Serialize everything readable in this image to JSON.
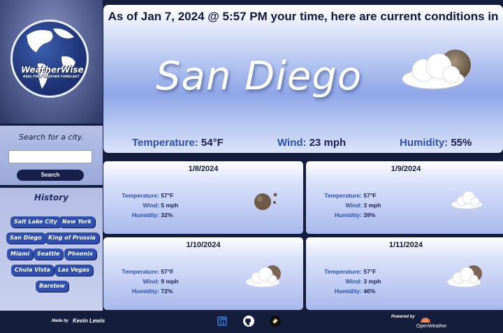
{
  "logo": {
    "brand": "WeatherWise",
    "tagline": "REAL-TIME WEATHER FORECAST"
  },
  "search": {
    "label": "Search for a city.",
    "value": "",
    "button": "Search"
  },
  "history": {
    "title": "History",
    "cities": [
      "Salt Lake City",
      "New York",
      "San Diego",
      "King of Prussia",
      "Miami",
      "Seattle",
      "Phoenix",
      "Chula Vista",
      "Las Vegas",
      "Barstow"
    ]
  },
  "current": {
    "headline": "As of Jan 7, 2024 @ 5:57 PM your time, here are current conditions in",
    "city": "San Diego",
    "icon": "night-partly-cloudy-icon",
    "temperature_label": "Temperature:",
    "temperature": "54°F",
    "wind_label": "Wind:",
    "wind": "23 mph",
    "humidity_label": "Humidity:",
    "humidity": "55%"
  },
  "forecast": [
    {
      "date": "1/8/2024",
      "icon": "night-clear-icon",
      "temp_label": "Temperature:",
      "temp": "57°F",
      "wind_label": "Wind:",
      "wind": "5 mph",
      "hum_label": "Humidity:",
      "humidity": "32%"
    },
    {
      "date": "1/9/2024",
      "icon": "cloud-icon",
      "temp_label": "Temperature:",
      "temp": "57°F",
      "wind_label": "Wind:",
      "wind": "3 mph",
      "hum_label": "Humidity:",
      "humidity": "39%"
    },
    {
      "date": "1/10/2024",
      "icon": "night-partly-cloudy-icon",
      "temp_label": "Temperature:",
      "temp": "57°F",
      "wind_label": "Wind:",
      "wind": "9 mph",
      "hum_label": "Humidity:",
      "humidity": "72%"
    },
    {
      "date": "1/11/2024",
      "icon": "night-partly-cloudy-icon",
      "temp_label": "Temperature:",
      "temp": "57°F",
      "wind_label": "Wind:",
      "wind": "3 mph",
      "hum_label": "Humidity:",
      "humidity": "46%"
    }
  ],
  "footer": {
    "made_by": "Made by",
    "author": "Kevin Lewis",
    "powered_by": "Powered by",
    "provider": "OpenWeather",
    "icons": [
      "linkedin-icon",
      "github-icon",
      "portfolio-icon"
    ]
  },
  "colors": {
    "navy": "#141d3b",
    "accent": "#2f4fae",
    "text": "#1a2050"
  }
}
